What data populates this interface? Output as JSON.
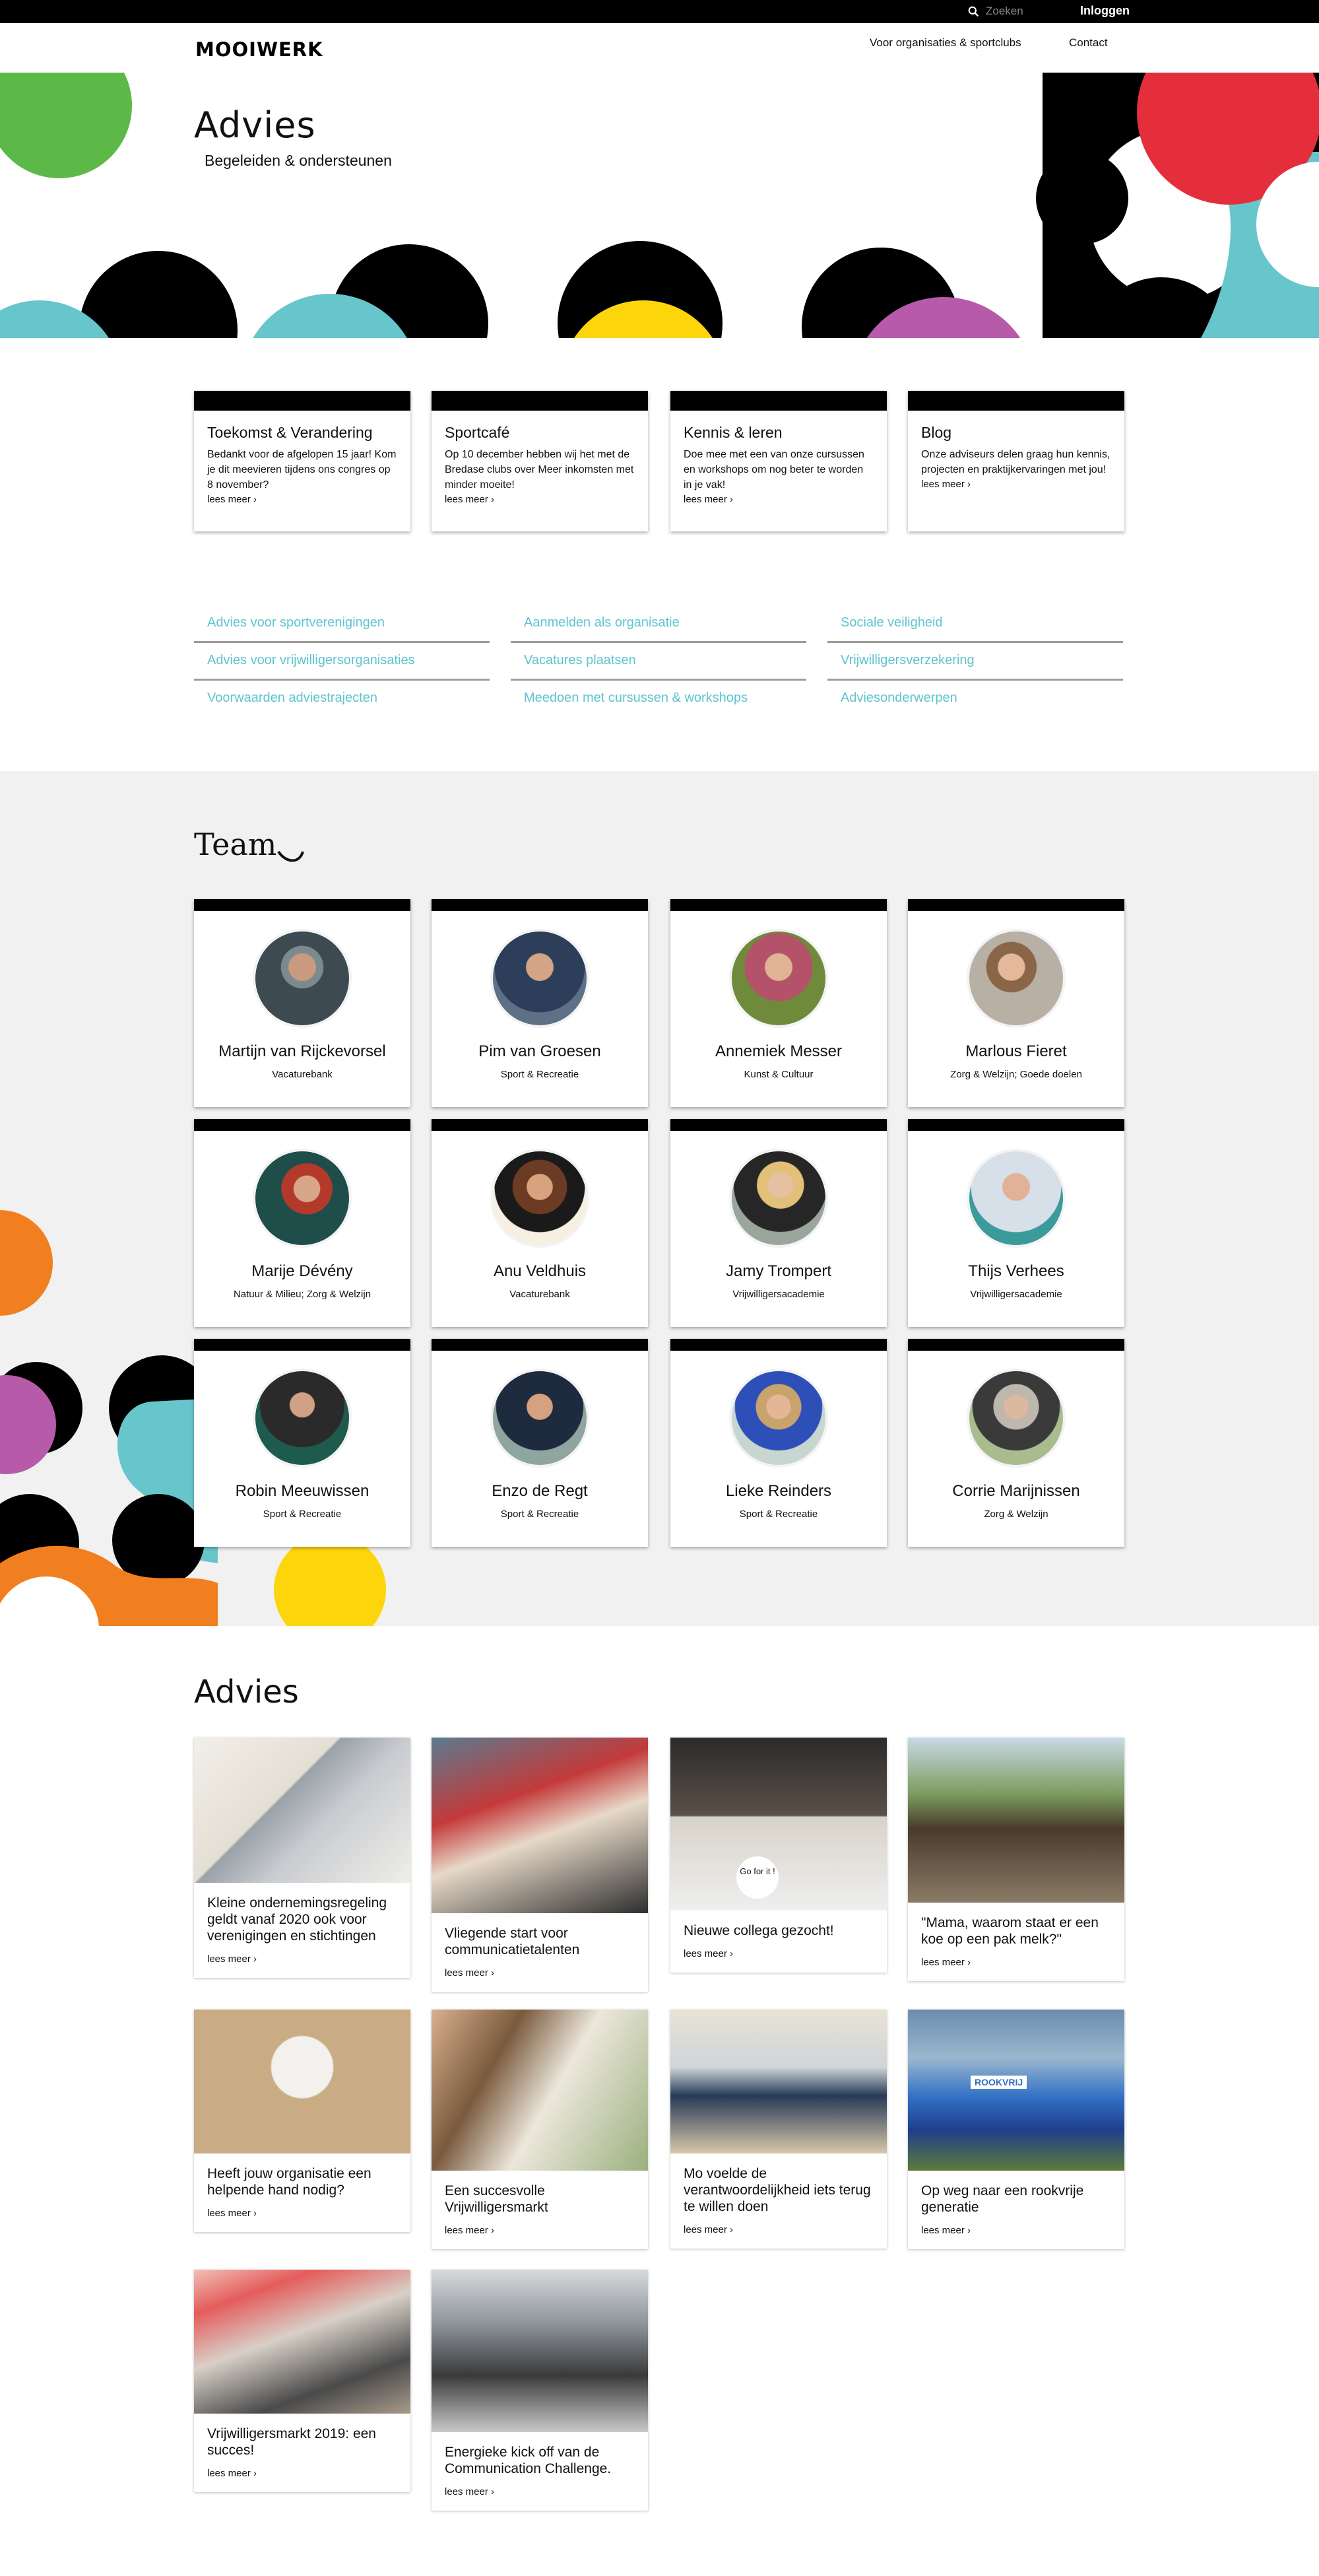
{
  "topbar": {
    "search_placeholder": "Zoeken",
    "login": "Inloggen"
  },
  "nav": {
    "logo": "MOOIWERK",
    "links": [
      "Voor organisaties & sportclubs",
      "Contact"
    ]
  },
  "hero": {
    "title": "Advies",
    "subtitle": "Begeleiden & ondersteunen"
  },
  "features": [
    {
      "title": "Toekomst & Verandering",
      "text": "Bedankt voor de afgelopen 15 jaar! Kom je dit meevieren tijdens ons congres op 8 november?",
      "more": "lees meer ›"
    },
    {
      "title": "Sportcafé",
      "text": "Op 10 december hebben wij het met de Bredase clubs over Meer inkomsten met minder moeite!",
      "more": "lees meer ›"
    },
    {
      "title": "Kennis & leren",
      "text": "Doe mee met een van onze cursussen en workshops om nog beter te worden in je vak!",
      "more": "lees meer ›"
    },
    {
      "title": "Blog",
      "text": "Onze adviseurs delen graag hun kennis, projecten en praktijkervaringen met jou!",
      "more": "lees meer ›"
    }
  ],
  "links": [
    [
      "Advies voor sportverenigingen",
      "Advies voor vrijwilligersorganisaties",
      "Voorwaarden adviestrajecten"
    ],
    [
      "Aanmelden als organisatie",
      "Vacatures plaatsen",
      "Meedoen met cursussen & workshops"
    ],
    [
      "Sociale veiligheid",
      "Vrijwilligersverzekering",
      "Adviesonderwerpen"
    ]
  ],
  "team": {
    "title": "Team",
    "members": [
      {
        "name": "Martijn van Rijckevorsel",
        "role": "Vacaturebank"
      },
      {
        "name": "Pim van Groesen",
        "role": "Sport & Recreatie"
      },
      {
        "name": "Annemiek Messer",
        "role": "Kunst & Cultuur"
      },
      {
        "name": "Marlous Fieret",
        "role": "Zorg & Welzijn; Goede doelen"
      },
      {
        "name": "Marije Dévény",
        "role": "Natuur & Milieu; Zorg & Welzijn"
      },
      {
        "name": "Anu Veldhuis",
        "role": "Vacaturebank"
      },
      {
        "name": "Jamy Trompert",
        "role": "Vrijwilligersacademie"
      },
      {
        "name": "Thijs Verhees",
        "role": "Vrijwilligersacademie"
      },
      {
        "name": "Robin Meeuwissen",
        "role": "Sport & Recreatie"
      },
      {
        "name": "Enzo de Regt",
        "role": "Sport & Recreatie"
      },
      {
        "name": "Lieke Reinders",
        "role": "Sport & Recreatie"
      },
      {
        "name": "Corrie Marijnissen",
        "role": "Zorg & Welzijn"
      }
    ]
  },
  "advies": {
    "title": "Advies",
    "items": [
      {
        "title": "Kleine ondernemingsregeling geldt vanaf 2020 ook voor verenigingen en stichtingen",
        "more": "lees meer ›"
      },
      {
        "title": "Vliegende start voor communicatietalenten",
        "more": "lees meer ›"
      },
      {
        "title": "Nieuwe collega gezocht!",
        "more": "lees meer ›",
        "image_text": "Go for it !"
      },
      {
        "title": "\"Mama, waarom staat er een koe op een pak melk?\"",
        "more": "lees meer ›"
      },
      {
        "title": "Heeft jouw organisatie een helpende hand nodig?",
        "more": "lees meer ›"
      },
      {
        "title": "Een succesvolle Vrijwilligersmarkt",
        "more": "lees meer ›"
      },
      {
        "title": "Mo voelde de verantwoordelijkheid iets terug te willen doen",
        "more": "lees meer ›"
      },
      {
        "title": "Op weg naar een rookvrije generatie",
        "more": "lees meer ›",
        "image_text": "ROOKVRIJ"
      },
      {
        "title": "Vrijwilligersmarkt 2019: een succes!",
        "more": "lees meer ›"
      },
      {
        "title": "Energieke kick off van de Communication Challenge.",
        "more": "lees meer ›"
      }
    ]
  },
  "colors": {
    "teal": "#67c6cc",
    "green": "#5cb947",
    "red": "#e42e3c",
    "yellow": "#fcd60a",
    "magenta": "#b75aa9",
    "orange": "#f27f1f",
    "link": "#5ec4cf"
  }
}
